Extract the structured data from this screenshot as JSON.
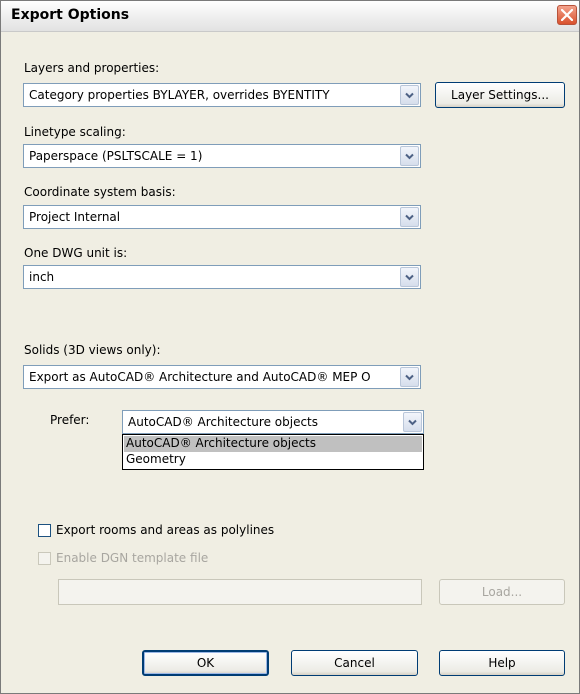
{
  "window": {
    "title": "Export Options"
  },
  "layers": {
    "label": "Layers and properties:",
    "value": "Category properties BYLAYER, overrides BYENTITY",
    "settings_button": "Layer Settings..."
  },
  "linetype": {
    "label": "Linetype scaling:",
    "value": "Paperspace (PSLTSCALE = 1)"
  },
  "coordinate": {
    "label": "Coordinate system basis:",
    "value": "Project Internal"
  },
  "dwg_unit": {
    "label": "One DWG unit is:",
    "value": "inch"
  },
  "solids": {
    "label": "Solids (3D views only):",
    "value": "Export as AutoCAD® Architecture and AutoCAD® MEP O"
  },
  "prefer": {
    "label": "Prefer:",
    "value": "AutoCAD® Architecture objects",
    "options": [
      "AutoCAD® Architecture objects",
      "Geometry"
    ]
  },
  "export_rooms": {
    "label": "Export rooms and areas as polylines",
    "checked": false
  },
  "dgn_template": {
    "label": "Enable DGN template file",
    "checked": false,
    "enabled": false,
    "path": ""
  },
  "buttons": {
    "load": "Load...",
    "ok": "OK",
    "cancel": "Cancel",
    "help": "Help"
  },
  "colors": {
    "face": "#f0eee3",
    "border": "#7f9db9",
    "close": "#d9512d"
  }
}
